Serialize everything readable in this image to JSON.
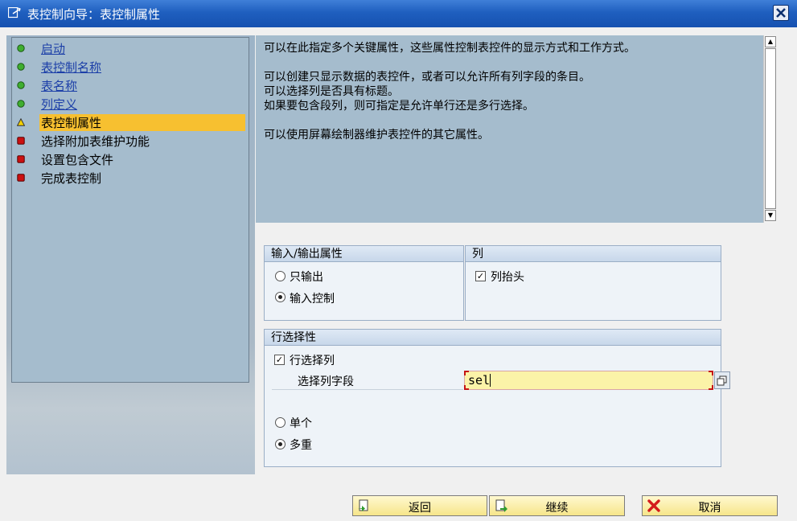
{
  "window": {
    "title": "表控制向导：表控制属性"
  },
  "nav": {
    "items": [
      {
        "label": "启动",
        "status": "done",
        "link": true
      },
      {
        "label": "表控制名称",
        "status": "done",
        "link": true
      },
      {
        "label": "表名称",
        "status": "done",
        "link": true
      },
      {
        "label": "列定义",
        "status": "done",
        "link": true
      },
      {
        "label": "表控制属性",
        "status": "current",
        "link": false
      },
      {
        "label": "选择附加表维护功能",
        "status": "pending",
        "link": false
      },
      {
        "label": "设置包含文件",
        "status": "pending",
        "link": false
      },
      {
        "label": "完成表控制",
        "status": "pending",
        "link": false
      }
    ]
  },
  "description": {
    "line1": "可以在此指定多个关键属性，这些属性控制表控件的显示方式和工作方式。",
    "line2": "可以创建只显示数据的表控件，或者可以允许所有列字段的条目。",
    "line3": "可以选择列是否具有标题。",
    "line4": "如果要包含段列，则可指定是允许单行还是多行选择。",
    "line5": "可以使用屏幕绘制器维护表控件的其它属性。"
  },
  "io_group": {
    "title": "输入/输出属性",
    "output_only": "只输出",
    "input_control": "输入控制",
    "selected": "input_control"
  },
  "col_group": {
    "title": "列",
    "column_header": "列抬头",
    "column_header_checked": true
  },
  "row_group": {
    "title": "行选择性",
    "row_select_column": "行选择列",
    "row_select_checked": true,
    "field_label": "选择列字段",
    "field_value": "sel",
    "single": "单个",
    "multiple": "多重",
    "selected": "multiple"
  },
  "buttons": {
    "back": "返回",
    "continue": "继续",
    "cancel": "取消"
  },
  "colors": {
    "titlebar": "#1f5fbf",
    "panel": "#a5bccd",
    "highlight": "#f7c030",
    "lamp_green": "#3fae2f",
    "lamp_red": "#cc1010",
    "lamp_yellow": "#f4d000"
  }
}
